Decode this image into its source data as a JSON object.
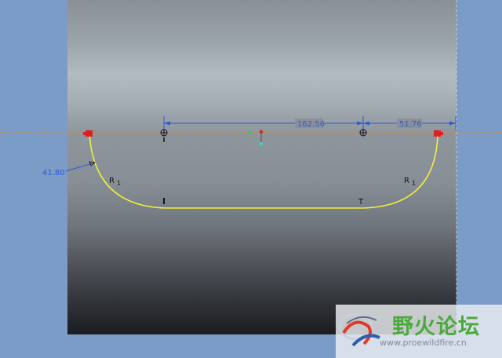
{
  "sketch": {
    "dimensions": {
      "horizontal_1": "162.56",
      "horizontal_2": "51.76",
      "diagonal": "41.80"
    },
    "radius_labels": [
      {
        "letter": "R",
        "sub": "1"
      },
      {
        "letter": "R",
        "sub": "1"
      }
    ],
    "tangent_mark": "T"
  },
  "watermark": {
    "title": "野火论坛",
    "url": "www.proewildfire.cn"
  },
  "colors": {
    "dimension": "#2a5bd7",
    "curve": "#f2ee3a",
    "endpoint": "#e02020",
    "centerline": "#d8882a",
    "background": "#7a9cc6"
  }
}
